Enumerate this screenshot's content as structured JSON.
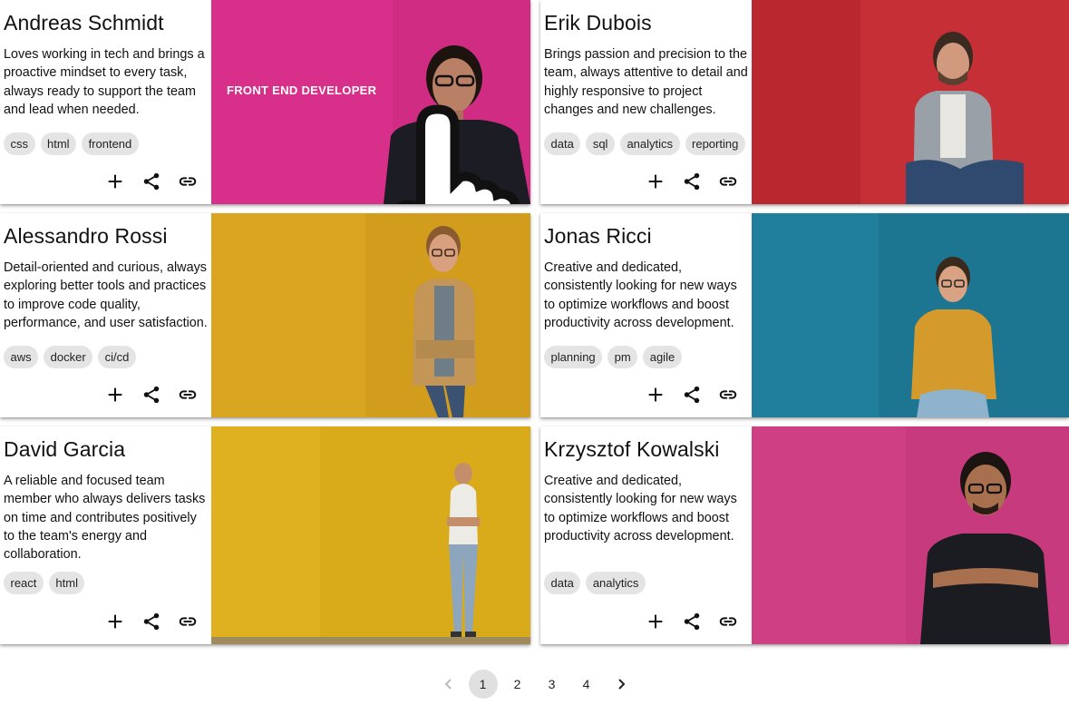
{
  "cards": [
    {
      "name": "Andreas Schmidt",
      "description": "Loves working in tech and brings a proactive mindset to every task, always ready to support the team and lead when needed.",
      "tags": [
        "css",
        "html",
        "frontend"
      ],
      "photo_bg": "#d8308a",
      "hover_label": "FRONT END DEVELOPER"
    },
    {
      "name": "Erik Dubois",
      "description": "Brings passion and precision to the team, always attentive to detail and highly responsive to project changes and new challenges.",
      "tags": [
        "data",
        "sql",
        "analytics",
        "reporting"
      ],
      "photo_bg": "#c62f35"
    },
    {
      "name": "Alessandro Rossi",
      "description": "Detail-oriented and curious, always exploring better tools and practices to improve code quality, performance, and user satisfaction.",
      "tags": [
        "aws",
        "docker",
        "ci/cd"
      ],
      "photo_bg": "#d9a420"
    },
    {
      "name": "Jonas Ricci",
      "description": "Creative and dedicated, consistently looking for new ways to optimize workflows and boost productivity across development.",
      "tags": [
        "planning",
        "pm",
        "agile"
      ],
      "photo_bg": "#1f7f9c"
    },
    {
      "name": "David Garcia",
      "description": "A reliable and focused team member who always delivers tasks on time and contributes positively to the team's energy and collaboration.",
      "tags": [
        "react",
        "html"
      ],
      "photo_bg": "#d9aa1a"
    },
    {
      "name": "Krzysztof Kowalski",
      "description": "Creative and dedicated, consistently looking for new ways to optimize workflows and boost productivity across development.",
      "tags": [
        "data",
        "analytics"
      ],
      "photo_bg": "#cf3f84"
    }
  ],
  "actions": {
    "add_icon": "plus-icon",
    "share_icon": "share-icon",
    "link_icon": "link-icon"
  },
  "pagination": {
    "prev_icon": "chevron-left-icon",
    "pages": [
      "1",
      "2",
      "3",
      "4"
    ],
    "current": "1",
    "next_icon": "chevron-right-icon"
  }
}
